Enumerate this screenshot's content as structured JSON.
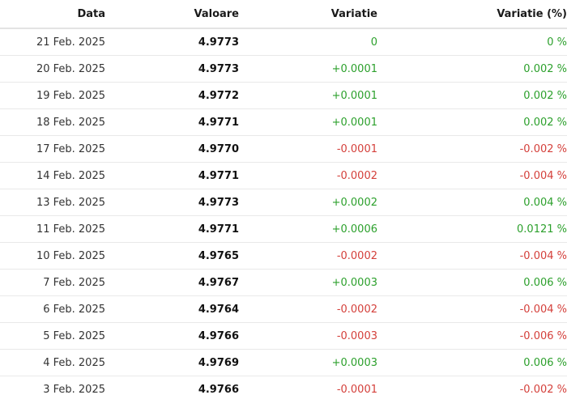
{
  "colors": {
    "positive": "#2ca02c",
    "negative": "#d43f3a",
    "header_text": "#1a1a1a",
    "divider": "#e9e9e9"
  },
  "table": {
    "headers": {
      "date": "Data",
      "value": "Valoare",
      "change": "Variatie",
      "change_pct": "Variatie (%)"
    },
    "rows": [
      {
        "date": "21 Feb. 2025",
        "value": "4.9773",
        "change": "0",
        "change_pct": "0 %",
        "trend": "up"
      },
      {
        "date": "20 Feb. 2025",
        "value": "4.9773",
        "change": "+0.0001",
        "change_pct": "0.002 %",
        "trend": "up"
      },
      {
        "date": "19 Feb. 2025",
        "value": "4.9772",
        "change": "+0.0001",
        "change_pct": "0.002 %",
        "trend": "up"
      },
      {
        "date": "18 Feb. 2025",
        "value": "4.9771",
        "change": "+0.0001",
        "change_pct": "0.002 %",
        "trend": "up"
      },
      {
        "date": "17 Feb. 2025",
        "value": "4.9770",
        "change": "-0.0001",
        "change_pct": "-0.002 %",
        "trend": "down"
      },
      {
        "date": "14 Feb. 2025",
        "value": "4.9771",
        "change": "-0.0002",
        "change_pct": "-0.004 %",
        "trend": "down"
      },
      {
        "date": "13 Feb. 2025",
        "value": "4.9773",
        "change": "+0.0002",
        "change_pct": "0.004 %",
        "trend": "up"
      },
      {
        "date": "11 Feb. 2025",
        "value": "4.9771",
        "change": "+0.0006",
        "change_pct": "0.0121 %",
        "trend": "up"
      },
      {
        "date": "10 Feb. 2025",
        "value": "4.9765",
        "change": "-0.0002",
        "change_pct": "-0.004 %",
        "trend": "down"
      },
      {
        "date": "7 Feb. 2025",
        "value": "4.9767",
        "change": "+0.0003",
        "change_pct": "0.006 %",
        "trend": "up"
      },
      {
        "date": "6 Feb. 2025",
        "value": "4.9764",
        "change": "-0.0002",
        "change_pct": "-0.004 %",
        "trend": "down"
      },
      {
        "date": "5 Feb. 2025",
        "value": "4.9766",
        "change": "-0.0003",
        "change_pct": "-0.006 %",
        "trend": "down"
      },
      {
        "date": "4 Feb. 2025",
        "value": "4.9769",
        "change": "+0.0003",
        "change_pct": "0.006 %",
        "trend": "up"
      },
      {
        "date": "3 Feb. 2025",
        "value": "4.9766",
        "change": "-0.0001",
        "change_pct": "-0.002 %",
        "trend": "down"
      }
    ]
  }
}
